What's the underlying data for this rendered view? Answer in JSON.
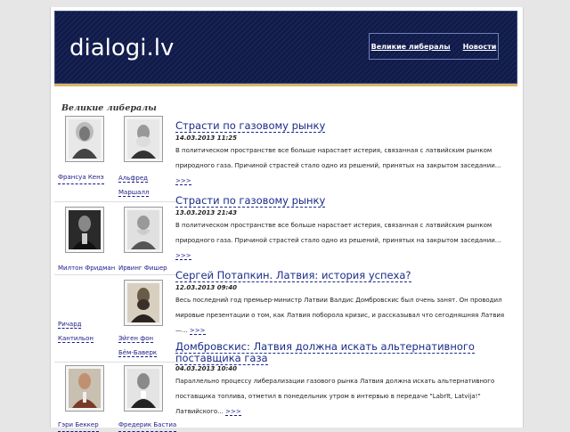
{
  "site": {
    "title": "dialogi.lv"
  },
  "topnav": {
    "items": [
      {
        "label": "Великие либералы"
      },
      {
        "label": "Новости"
      }
    ]
  },
  "sidebar": {
    "title": "Великие либералы",
    "people": [
      {
        "name": "Франсуа Кенэ",
        "icon": "portrait-icon"
      },
      {
        "name": "Альфред Маршалл",
        "icon": "portrait-icon"
      },
      {
        "name": "Милтон Фридман",
        "icon": "portrait-icon"
      },
      {
        "name": "Ирвинг Фишер",
        "icon": "portrait-icon"
      },
      {
        "name": "Ричард Кантильон",
        "icon": "portrait-icon"
      },
      {
        "name": "Эйген фон Бём-Баверк",
        "icon": "portrait-icon"
      },
      {
        "name": "Гэри Беккер",
        "icon": "portrait-icon"
      },
      {
        "name": "Фредерик Бастиа",
        "icon": "portrait-icon"
      }
    ]
  },
  "articles": [
    {
      "title": "Страсти по газовому рынку",
      "date": "14.03.2013 11:25",
      "text": "В политическом пространстве все больше нарастает истерия, связанная с латвийским рынком природного газа. Причиной страстей стало одно из решений, принятых на закрытом заседании...",
      "more": ">>>"
    },
    {
      "title": "Страсти по газовому рынку",
      "date": "13.03.2013 21:43",
      "text": "В политическом пространстве все больше нарастает истерия, связанная с латвийским рынком природного газа. Причиной страстей стало одно из решений, принятых на закрытом заседании...",
      "more": ">>>"
    },
    {
      "title": "Сергей Потапкин. Латвия: история успеха?",
      "date": "12.03.2013 09:40",
      "text": "Весь последний год премьер-министр Латвии Валдис Домбровскис был очень занят. Он проводил мировые презентации о том, как Латвия поборола кризис, и рассказывал что сегодняшняя Латвия —...",
      "more": ">>>"
    },
    {
      "title": "Домбровскис: Латвия должна искать альтернативного поставщика газа",
      "date": "04.03.2013 10:40",
      "text": "Параллельно процессу либерализации газового рынка Латвия должна искать альтернативного поставщика топлива, отметил в понедельник утром в интервью в передаче \"Labrīt, Latvija!\" Латвийского...",
      "more": ">>>"
    }
  ],
  "colors": {
    "header_bg": "#0f1a4a",
    "accent_line": "#d8b66a",
    "link": "#1a2a88"
  }
}
